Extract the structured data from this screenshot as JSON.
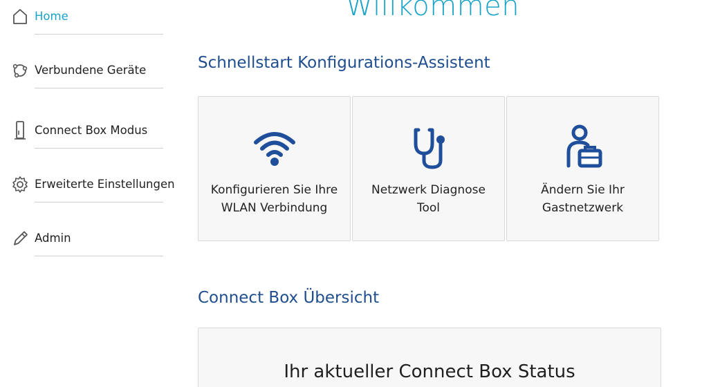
{
  "welcome_title": "Willkommen",
  "sidebar": {
    "items": [
      {
        "label": "Home",
        "icon": "home-icon",
        "active": true
      },
      {
        "label": "Verbundene Geräte",
        "icon": "connected-devices-icon",
        "active": false
      },
      {
        "label": "Connect Box Modus",
        "icon": "router-icon",
        "active": false
      },
      {
        "label": "Erweiterte Einstellungen",
        "icon": "gear-icon",
        "active": false
      },
      {
        "label": "Admin",
        "icon": "pencil-icon",
        "active": false
      }
    ]
  },
  "quickstart": {
    "title": "Schnellstart Konfigurations-Assistent",
    "cards": [
      {
        "line1": "Konfigurieren Sie Ihre",
        "line2": "WLAN Verbindung",
        "icon": "wifi-icon"
      },
      {
        "line1": "Netzwerk Diagnose",
        "line2": "Tool",
        "icon": "stethoscope-icon"
      },
      {
        "line1": "Ändern Sie Ihr",
        "line2": "Gastnetzwerk",
        "icon": "guest-network-icon"
      }
    ]
  },
  "overview": {
    "title": "Connect Box Übersicht",
    "status_title": "Ihr aktueller Connect Box Status"
  },
  "colors": {
    "accent": "#1aa3c8",
    "heading": "#1f4e8f",
    "icon_blue": "#1f4e9a"
  }
}
